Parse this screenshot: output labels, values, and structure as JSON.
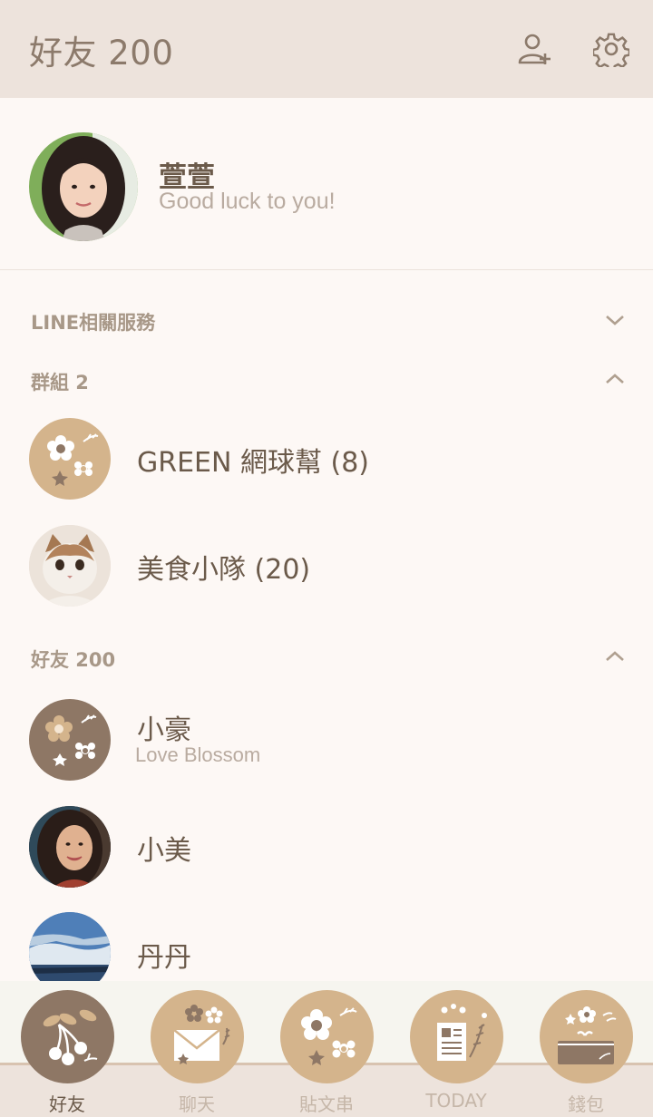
{
  "header": {
    "title": "好友 200",
    "add_friend_icon": "add-friend-icon",
    "settings_icon": "gear-icon"
  },
  "profile": {
    "name": "萱萱",
    "status": "Good luck to you!"
  },
  "sections": {
    "line_services": {
      "label": "LINE相關服務",
      "state": "collapsed"
    },
    "groups": {
      "label": "群組 2",
      "state": "expanded"
    },
    "friends": {
      "label": "好友 200",
      "state": "expanded"
    }
  },
  "groups": [
    {
      "name": "GREEN 網球幫 (8)"
    },
    {
      "name": "美食小隊 (20)"
    }
  ],
  "friends": [
    {
      "name": "小豪",
      "status": "Love Blossom"
    },
    {
      "name": "小美"
    },
    {
      "name": "丹丹"
    }
  ],
  "tabs": [
    {
      "label": "好友",
      "active": true,
      "icon": "cherries-icon"
    },
    {
      "label": "聊天",
      "active": false,
      "icon": "envelope-icon"
    },
    {
      "label": "貼文串",
      "active": false,
      "icon": "flower-icon"
    },
    {
      "label": "TODAY",
      "active": false,
      "icon": "newspaper-icon"
    },
    {
      "label": "錢包",
      "active": false,
      "icon": "wallet-icon"
    }
  ],
  "colors": {
    "header_bg": "#ede3dc",
    "accent_tan": "#d4b48c",
    "accent_brown": "#8e7765",
    "text": "#6b5a4a",
    "muted": "#b9aba0"
  }
}
